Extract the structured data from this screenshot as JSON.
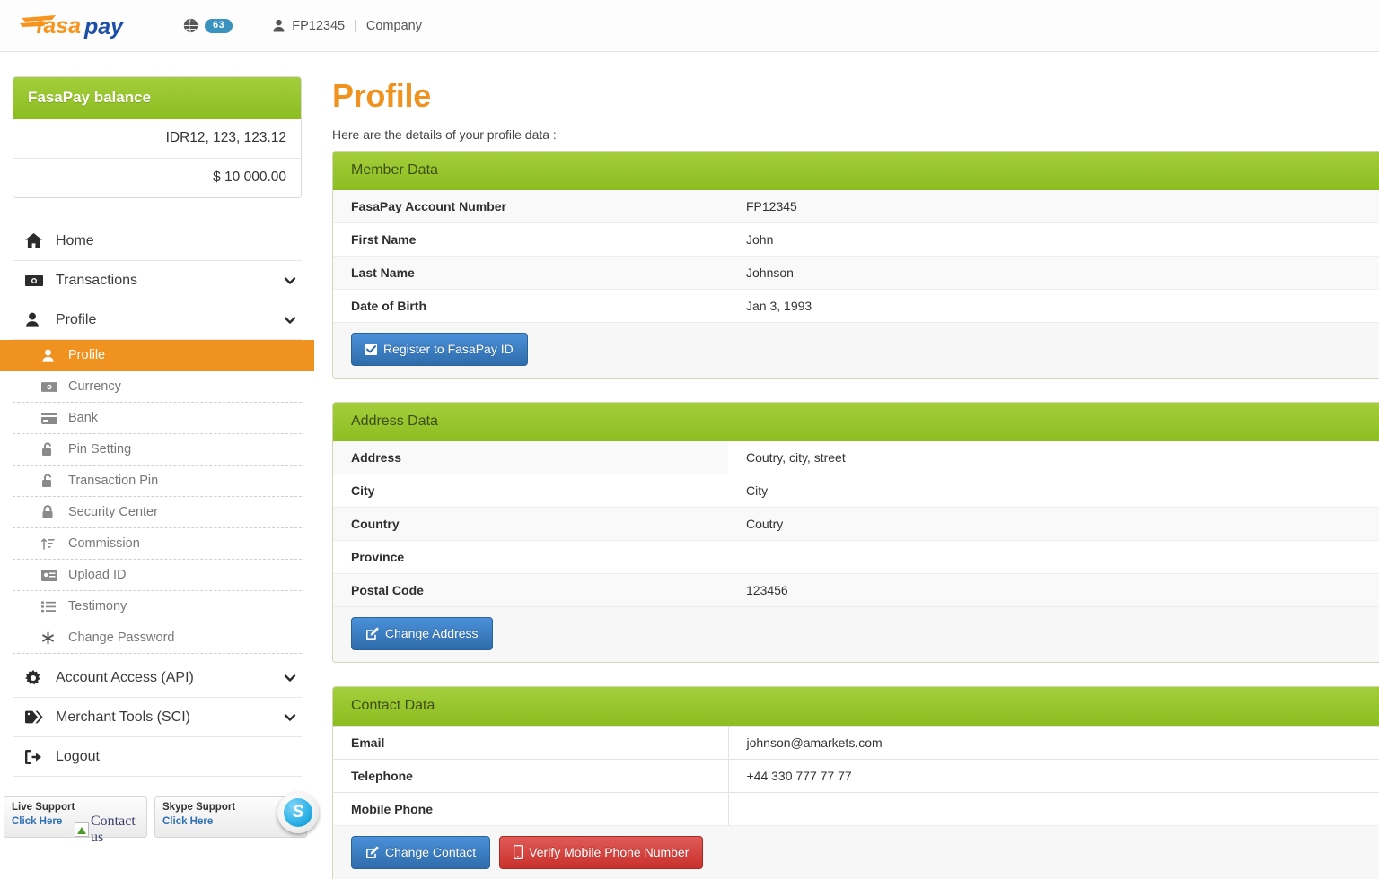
{
  "header": {
    "logo_text": "fasapay",
    "globe_icon": "globe-icon",
    "language_badge": "63",
    "user_icon": "user-icon",
    "account_id": "FP12345",
    "separator": "|",
    "company_label": "Company"
  },
  "sidebar": {
    "balance": {
      "title": "FasaPay balance",
      "rows": [
        "IDR12, 123, 123.12",
        "$ 10 000.00"
      ]
    },
    "nav": [
      {
        "label": "Home",
        "icon": "home-icon",
        "chevron": false
      },
      {
        "label": "Transactions",
        "icon": "money-icon",
        "chevron": true
      },
      {
        "label": "Profile",
        "icon": "user-icon",
        "chevron": true
      }
    ],
    "sub_items": [
      {
        "label": "Profile",
        "icon": "user-icon",
        "active": true
      },
      {
        "label": "Currency",
        "icon": "money-icon",
        "active": false
      },
      {
        "label": "Bank",
        "icon": "bank-card-icon",
        "active": false
      },
      {
        "label": "Pin Setting",
        "icon": "unlock-icon",
        "active": false
      },
      {
        "label": "Transaction Pin",
        "icon": "unlock-icon",
        "active": false
      },
      {
        "label": "Security Center",
        "icon": "lock-icon",
        "active": false
      },
      {
        "label": "Commission",
        "icon": "sort-amount-icon",
        "active": false
      },
      {
        "label": "Upload ID",
        "icon": "id-card-icon",
        "active": false
      },
      {
        "label": "Testimony",
        "icon": "list-icon",
        "active": false
      },
      {
        "label": "Change Password",
        "icon": "asterisk-icon",
        "active": false
      }
    ],
    "nav_bottom": [
      {
        "label": "Account Access (API)",
        "icon": "gear-icon",
        "chevron": true
      },
      {
        "label": "Merchant Tools (SCI)",
        "icon": "tag-icon",
        "chevron": true
      },
      {
        "label": "Logout",
        "icon": "logout-icon",
        "chevron": false
      }
    ],
    "support": {
      "live": {
        "title": "Live Support",
        "link": "Click Here",
        "image_alt": "Contact us"
      },
      "skype": {
        "title": "Skype Support",
        "link": "Click Here",
        "icon": "skype-icon"
      }
    }
  },
  "main": {
    "title": "Profile",
    "subtitle": "Here are the details of your profile data :",
    "member_panel": {
      "heading": "Member Data",
      "rows": [
        {
          "key": "FasaPay Account Number",
          "value": "FP12345"
        },
        {
          "key": "First Name",
          "value": "John"
        },
        {
          "key": "Last Name",
          "value": "Johnson"
        },
        {
          "key": "Date of Birth",
          "value": "Jan 3, 1993"
        }
      ],
      "button": {
        "label": "Register to FasaPay ID",
        "icon": "checkbox-icon",
        "color": "#3276b1"
      }
    },
    "address_panel": {
      "heading": "Address Data",
      "rows": [
        {
          "key": "Address",
          "value": "Coutry, city, street"
        },
        {
          "key": "City",
          "value": "City"
        },
        {
          "key": "Country",
          "value": "Coutry"
        },
        {
          "key": "Province",
          "value": ""
        },
        {
          "key": "Postal Code",
          "value": "123456"
        }
      ],
      "button": {
        "label": "Change Address",
        "icon": "pencil-square-icon",
        "color": "#3276b1"
      }
    },
    "contact_panel": {
      "heading": "Contact Data",
      "rows": [
        {
          "key": "Email",
          "value": "johnson@amarkets.com"
        },
        {
          "key": "Telephone",
          "value": "+44 330 777 77 77"
        },
        {
          "key": "Mobile Phone",
          "value": ""
        }
      ],
      "buttons": [
        {
          "label": "Change Contact",
          "icon": "pencil-square-icon",
          "color": "#3276b1"
        },
        {
          "label": "Verify Mobile Phone Number",
          "icon": "mobile-icon",
          "color": "#c9302c"
        }
      ]
    }
  },
  "colors": {
    "brand_orange": "#f0921f",
    "brand_green": "#8cbd20",
    "brand_blue": "#2f6cab",
    "danger_red": "#c9302c",
    "logo_blue": "#1e4fa8"
  }
}
